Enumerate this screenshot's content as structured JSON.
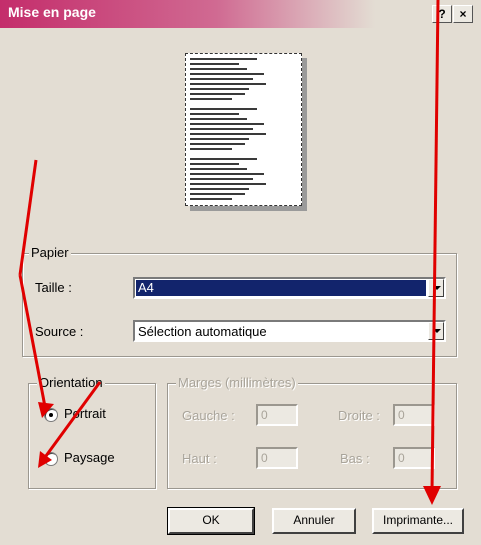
{
  "window": {
    "title": "Mise en page",
    "help_label": "?",
    "close_label": "×"
  },
  "paper_group": {
    "legend": "Papier",
    "size_label": "Taille :",
    "size_value": "A4",
    "source_label": "Source :",
    "source_value": "Sélection automatique"
  },
  "orientation_group": {
    "legend": "Orientation",
    "portrait_label": "Portrait",
    "landscape_label": "Paysage",
    "selected": "Portrait"
  },
  "margins_group": {
    "legend": "Marges (millimètres)",
    "left_label": "Gauche :",
    "left_value": "0",
    "right_label": "Droite :",
    "right_value": "0",
    "top_label": "Haut :",
    "top_value": "0",
    "bottom_label": "Bas :",
    "bottom_value": "0"
  },
  "buttons": {
    "ok_label": "OK",
    "cancel_label": "Annuler",
    "printer_label": "Imprimante..."
  },
  "annotation": {
    "arrow_color": "#e00000"
  }
}
